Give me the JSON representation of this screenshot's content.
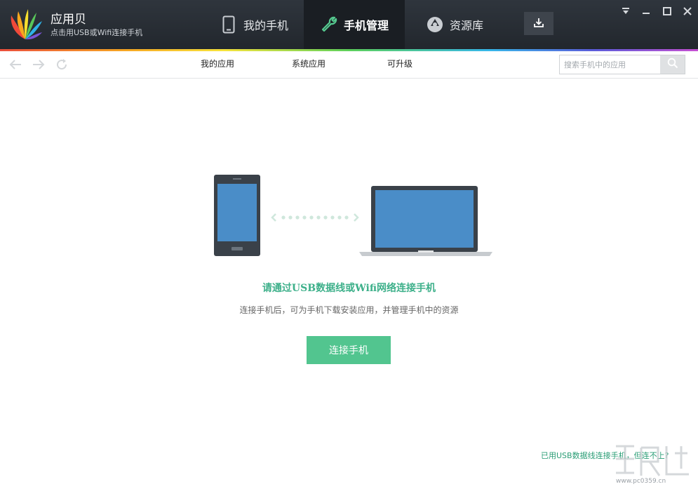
{
  "app": {
    "name": "应用贝",
    "subtitle": "点击用USB或Wifi连接手机"
  },
  "nav": {
    "tabs": [
      {
        "label": "我的手机",
        "icon": "phone-icon",
        "active": false
      },
      {
        "label": "手机管理",
        "icon": "wrench-icon",
        "active": true
      },
      {
        "label": "资源库",
        "icon": "aperture-icon",
        "active": false
      }
    ],
    "download_icon": "download-icon"
  },
  "window_controls": [
    "dropdown-icon",
    "minimize-icon",
    "maximize-icon",
    "close-icon"
  ],
  "toolbar": {
    "back_icon": "back-arrow-icon",
    "forward_icon": "forward-arrow-icon",
    "refresh_icon": "refresh-icon",
    "subtabs": [
      "我的应用",
      "系统应用",
      "可升级"
    ],
    "search": {
      "placeholder": "搜索手机中的应用",
      "value": ""
    }
  },
  "main": {
    "headline": "请通过USB数据线或Wifi网络连接手机",
    "description": "连接手机后，可为手机下载安装应用，并管理手机中的资源",
    "connect_label": "连接手机",
    "help_link": "已用USB数据线连接手机，但连不上?"
  },
  "watermark": {
    "text": "www.pc0359.cn"
  },
  "colors": {
    "titlebar": "#2a2f36",
    "accent_green": "#52c58f",
    "headline_green": "#3db08a",
    "device_screen": "#4a8dc8",
    "device_body": "#3a4149"
  }
}
